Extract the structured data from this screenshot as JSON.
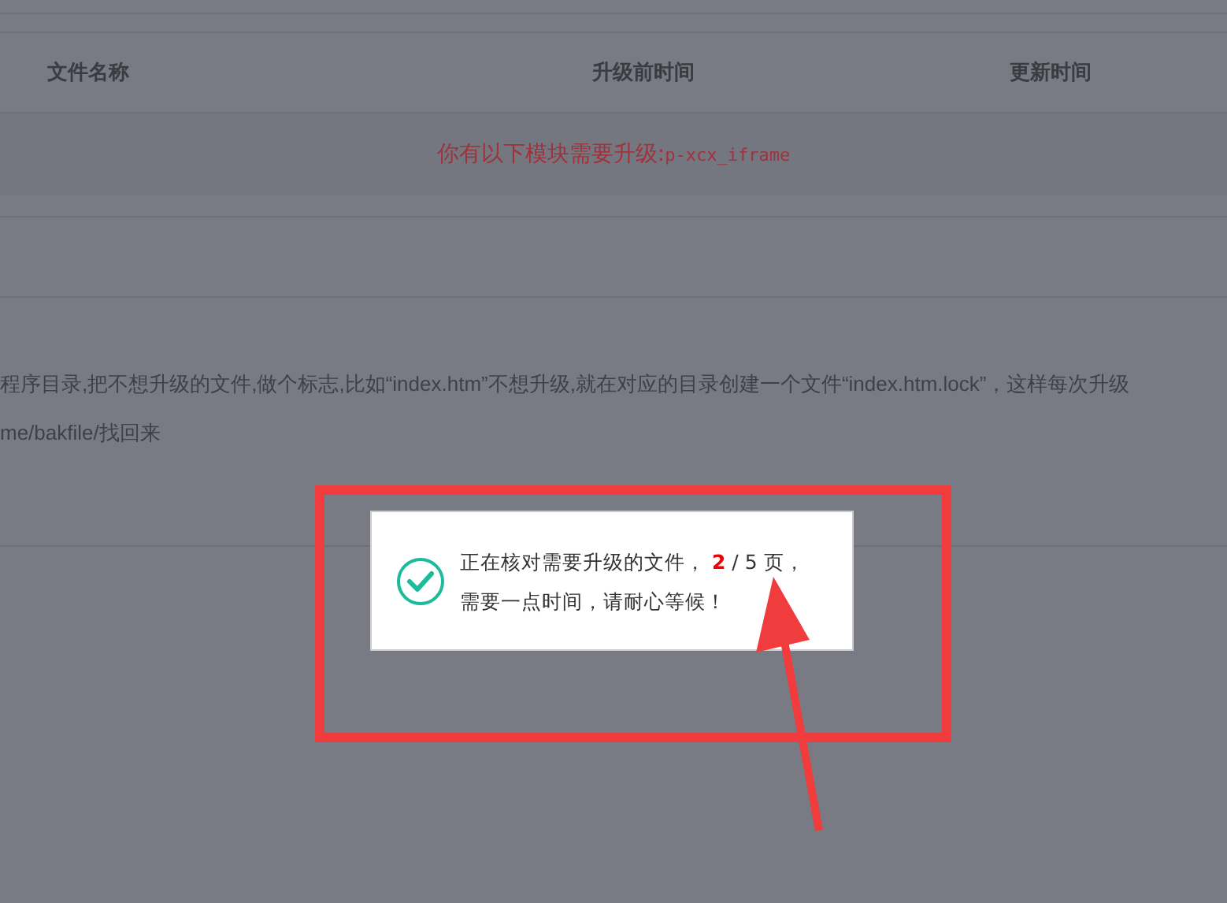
{
  "table": {
    "columns": [
      "文件名称",
      "升级前时间",
      "更新时间"
    ],
    "notice": {
      "text": "你有以下模块需要升级:",
      "module": "p-xcx_iframe"
    }
  },
  "instructions": [
    "程序目录,把不想升级的文件,做个标志,比如“index.htm”不想升级,就在对应的目录创建一个文件“index.htm.lock”，这样每次升级",
    "me/bakfile/找回来"
  ],
  "dialog": {
    "message": "正在核对需要升级的文件， **2** / 5 页，需要一点时间，请耐心等候！"
  }
}
